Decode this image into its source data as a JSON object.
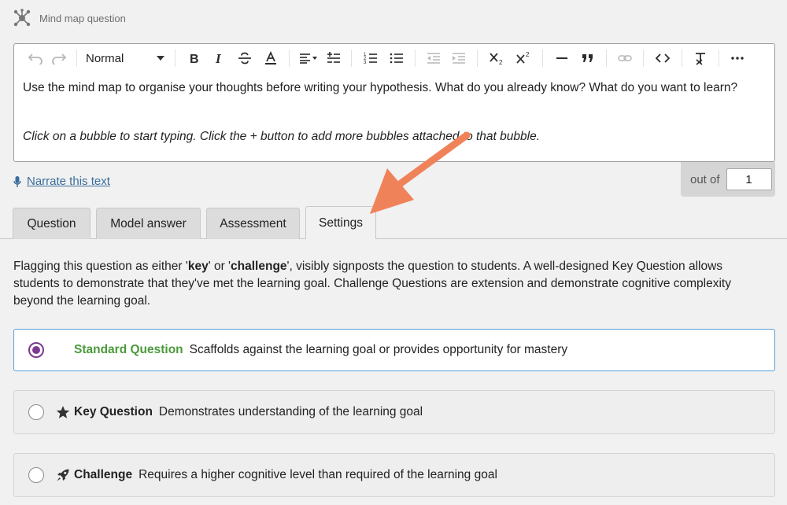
{
  "header": {
    "title": "Mind map question",
    "icon": "mind-map-icon"
  },
  "toolbar": {
    "format_label": "Normal",
    "buttons": [
      "undo-icon",
      "redo-icon",
      "bold-icon",
      "italic-icon",
      "strikethrough-icon",
      "text-color-icon",
      "align-icon",
      "line-spacing-icon",
      "ordered-list-icon",
      "bullet-list-icon",
      "outdent-icon",
      "indent-icon",
      "subscript-icon",
      "superscript-icon",
      "horizontal-rule-icon",
      "quote-icon",
      "link-icon",
      "code-icon",
      "clear-format-icon",
      "more-icon"
    ]
  },
  "editor": {
    "line1": "Use the mind map to organise your thoughts before writing your hypothesis. What do you already know? What do you want to learn?",
    "line2": "Click on a bubble to start typing. Click the + button to add more bubbles attached to that bubble."
  },
  "narrate": {
    "label": "Narrate this text"
  },
  "score": {
    "label": "out of",
    "value": "1"
  },
  "tabs": [
    {
      "label": "Question",
      "active": false
    },
    {
      "label": "Model answer",
      "active": false
    },
    {
      "label": "Assessment",
      "active": false
    },
    {
      "label": "Settings",
      "active": true
    }
  ],
  "settings": {
    "desc_prefix": "Flagging this question as either '",
    "key_word": "key",
    "desc_mid": "' or '",
    "challenge_word": "challenge",
    "desc_suffix": "', visibly signposts the question to students. A well-designed Key Question allows students to demonstrate that they've met the learning goal. Challenge Questions are extension and demonstrate cognitive complexity beyond the learning goal."
  },
  "options": [
    {
      "name": "Standard Question",
      "desc": "Scaffolds against the learning goal or provides opportunity for mastery",
      "selected": true,
      "icon": ""
    },
    {
      "name": "Key Question",
      "desc": "Demonstrates understanding of the learning goal",
      "selected": false,
      "icon": "star-icon"
    },
    {
      "name": "Challenge",
      "desc": "Requires a higher cognitive level than required of the learning goal",
      "selected": false,
      "icon": "rocket-icon"
    }
  ],
  "colors": {
    "accent_purple": "#7b3a8f",
    "standard_green": "#4a9a3a",
    "link_blue": "#3a6e9c",
    "selected_border": "#5aa0d8",
    "annotation_arrow": "#f0825a"
  }
}
